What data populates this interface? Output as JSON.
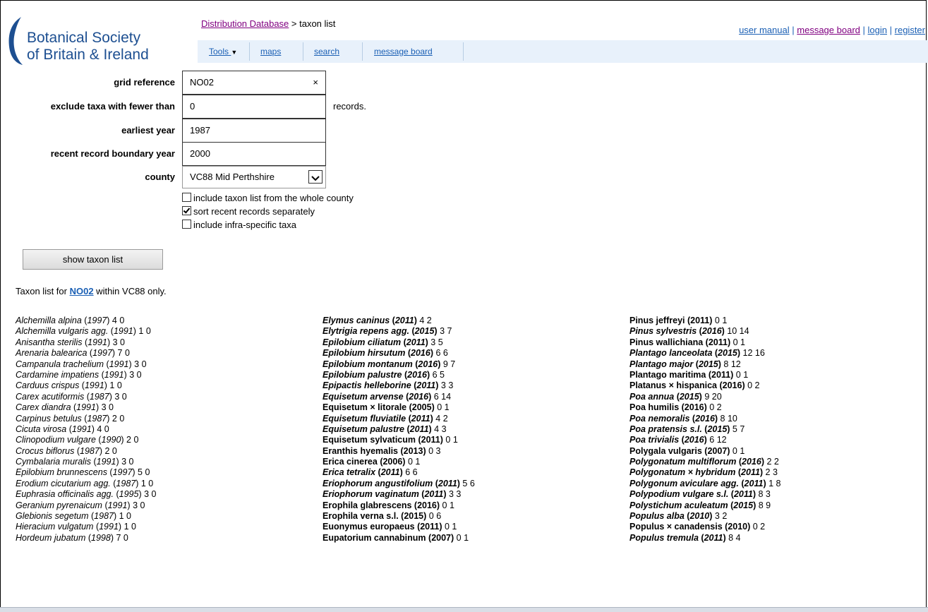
{
  "header": {
    "logo_line1": "Botanical Society",
    "logo_line2": "of Britain & Ireland",
    "breadcrumb_link": "Distribution Database",
    "breadcrumb_rest": " > taxon list",
    "toplinks": [
      "user manual",
      "message board",
      "login",
      "register"
    ]
  },
  "nav": {
    "tools": "Tools",
    "maps": "maps",
    "search": "search",
    "message_board": "message board"
  },
  "form": {
    "grid_reference_label": "grid reference",
    "grid_reference_value": "NO02",
    "clear_symbol": "×",
    "exclude_label": "exclude taxa with fewer than",
    "exclude_value": "0",
    "records_suffix": "records.",
    "earliest_year_label": "earliest year",
    "earliest_year_value": "1987",
    "boundary_label": "recent record boundary year",
    "boundary_value": "2000",
    "county_label": "county",
    "county_value": "VC88 Mid Perthshire",
    "cb_whole_county": "include taxon list from the whole county",
    "cb_sort_recent": "sort recent records separately",
    "cb_infra": "include infra-specific taxa",
    "show_button": "show taxon list"
  },
  "summary": {
    "prefix": "Taxon list for ",
    "grid": "NO02",
    "suffix": " within VC88 only."
  },
  "columns": [
    [
      {
        "name": "Alchemilla alpina",
        "year": "1997",
        "counts": "4 0",
        "style": "italic"
      },
      {
        "name": "Alchemilla vulgaris agg.",
        "year": "1991",
        "counts": "1 0",
        "style": "italic"
      },
      {
        "name": "Anisantha sterilis",
        "year": "1991",
        "counts": "3 0",
        "style": "italic"
      },
      {
        "name": "Arenaria balearica",
        "year": "1997",
        "counts": "7 0",
        "style": "italic"
      },
      {
        "name": "Campanula trachelium",
        "year": "1991",
        "counts": "3 0",
        "style": "italic"
      },
      {
        "name": "Cardamine impatiens",
        "year": "1991",
        "counts": "3 0",
        "style": "italic"
      },
      {
        "name": "Carduus crispus",
        "year": "1991",
        "counts": "1 0",
        "style": "italic"
      },
      {
        "name": "Carex acutiformis",
        "year": "1987",
        "counts": "3 0",
        "style": "italic"
      },
      {
        "name": "Carex diandra",
        "year": "1991",
        "counts": "3 0",
        "style": "italic"
      },
      {
        "name": "Carpinus betulus",
        "year": "1987",
        "counts": "2 0",
        "style": "italic"
      },
      {
        "name": "Cicuta virosa",
        "year": "1991",
        "counts": "4 0",
        "style": "italic"
      },
      {
        "name": "Clinopodium vulgare",
        "year": "1990",
        "counts": "2 0",
        "style": "italic"
      },
      {
        "name": "Crocus biflorus",
        "year": "1987",
        "counts": "2 0",
        "style": "italic"
      },
      {
        "name": "Cymbalaria muralis",
        "year": "1991",
        "counts": "3 0",
        "style": "italic"
      },
      {
        "name": "Epilobium brunnescens",
        "year": "1997",
        "counts": "5 0",
        "style": "italic"
      },
      {
        "name": "Erodium cicutarium agg.",
        "year": "1987",
        "counts": "1 0",
        "style": "italic"
      },
      {
        "name": "Euphrasia officinalis agg.",
        "year": "1995",
        "counts": "3 0",
        "style": "italic"
      },
      {
        "name": "Geranium pyrenaicum",
        "year": "1991",
        "counts": "3 0",
        "style": "italic"
      },
      {
        "name": "Glebionis segetum",
        "year": "1987",
        "counts": "1 0",
        "style": "italic"
      },
      {
        "name": "Hieracium vulgatum",
        "year": "1991",
        "counts": "1 0",
        "style": "italic"
      },
      {
        "name": "Hordeum jubatum",
        "year": "1998",
        "counts": "7 0",
        "style": "italic"
      }
    ],
    [
      {
        "name": "Elymus caninus",
        "year": "2011",
        "counts": "4 2",
        "style": "bold-italic"
      },
      {
        "name": "Elytrigia repens agg.",
        "year": "2015",
        "counts": "3 7",
        "style": "bold-italic"
      },
      {
        "name": "Epilobium ciliatum",
        "year": "2011",
        "counts": "3 5",
        "style": "bold-italic"
      },
      {
        "name": "Epilobium hirsutum",
        "year": "2016",
        "counts": "6 6",
        "style": "bold-italic"
      },
      {
        "name": "Epilobium montanum",
        "year": "2016",
        "counts": "9 7",
        "style": "bold-italic"
      },
      {
        "name": "Epilobium palustre",
        "year": "2016",
        "counts": "6 5",
        "style": "bold-italic"
      },
      {
        "name": "Epipactis helleborine",
        "year": "2011",
        "counts": "3 3",
        "style": "bold-italic"
      },
      {
        "name": "Equisetum arvense",
        "year": "2016",
        "counts": "6 14",
        "style": "bold-italic"
      },
      {
        "name": "Equisetum × litorale",
        "year": "2005",
        "counts": "0 1",
        "style": "bold"
      },
      {
        "name": "Equisetum fluviatile",
        "year": "2011",
        "counts": "4 2",
        "style": "bold-italic"
      },
      {
        "name": "Equisetum palustre",
        "year": "2011",
        "counts": "4 3",
        "style": "bold-italic"
      },
      {
        "name": "Equisetum sylvaticum",
        "year": "2011",
        "counts": "0 1",
        "style": "bold"
      },
      {
        "name": "Eranthis hyemalis",
        "year": "2013",
        "counts": "0 3",
        "style": "bold"
      },
      {
        "name": "Erica cinerea",
        "year": "2006",
        "counts": "0 1",
        "style": "bold"
      },
      {
        "name": "Erica tetralix",
        "year": "2011",
        "counts": "6 6",
        "style": "bold-italic"
      },
      {
        "name": "Eriophorum angustifolium",
        "year": "2011",
        "counts": "5 6",
        "style": "bold-italic"
      },
      {
        "name": "Eriophorum vaginatum",
        "year": "2011",
        "counts": "3 3",
        "style": "bold-italic"
      },
      {
        "name": "Erophila glabrescens",
        "year": "2016",
        "counts": "0 1",
        "style": "bold"
      },
      {
        "name": "Erophila verna s.l.",
        "year": "2015",
        "counts": "0 6",
        "style": "bold"
      },
      {
        "name": "Euonymus europaeus",
        "year": "2011",
        "counts": "0 1",
        "style": "bold"
      },
      {
        "name": "Eupatorium cannabinum",
        "year": "2007",
        "counts": "0 1",
        "style": "bold"
      }
    ],
    [
      {
        "name": "Pinus jeffreyi",
        "year": "2011",
        "counts": "0 1",
        "style": "bold"
      },
      {
        "name": "Pinus sylvestris",
        "year": "2016",
        "counts": "10 14",
        "style": "bold-italic"
      },
      {
        "name": "Pinus wallichiana",
        "year": "2011",
        "counts": "0 1",
        "style": "bold"
      },
      {
        "name": "Plantago lanceolata",
        "year": "2015",
        "counts": "12 16",
        "style": "bold-italic"
      },
      {
        "name": "Plantago major",
        "year": "2015",
        "counts": "8 12",
        "style": "bold-italic"
      },
      {
        "name": "Plantago maritima",
        "year": "2011",
        "counts": "0 1",
        "style": "bold"
      },
      {
        "name": "Platanus × hispanica",
        "year": "2016",
        "counts": "0 2",
        "style": "bold"
      },
      {
        "name": "Poa annua",
        "year": "2015",
        "counts": "9 20",
        "style": "bold-italic"
      },
      {
        "name": "Poa humilis",
        "year": "2016",
        "counts": "0 2",
        "style": "bold"
      },
      {
        "name": "Poa nemoralis",
        "year": "2016",
        "counts": "8 10",
        "style": "bold-italic"
      },
      {
        "name": "Poa pratensis s.l.",
        "year": "2015",
        "counts": "5 7",
        "style": "bold-italic"
      },
      {
        "name": "Poa trivialis",
        "year": "2016",
        "counts": "6 12",
        "style": "bold-italic"
      },
      {
        "name": "Polygala vulgaris",
        "year": "2007",
        "counts": "0 1",
        "style": "bold"
      },
      {
        "name": "Polygonatum multiflorum",
        "year": "2016",
        "counts": "2 2",
        "style": "bold-italic"
      },
      {
        "name": "Polygonatum × hybridum",
        "year": "2011",
        "counts": "2 3",
        "style": "bold-italic"
      },
      {
        "name": "Polygonum aviculare agg.",
        "year": "2011",
        "counts": "1 8",
        "style": "bold-italic"
      },
      {
        "name": "Polypodium vulgare s.l.",
        "year": "2011",
        "counts": "8 3",
        "style": "bold-italic"
      },
      {
        "name": "Polystichum aculeatum",
        "year": "2015",
        "counts": "8 9",
        "style": "bold-italic"
      },
      {
        "name": "Populus alba",
        "year": "2010",
        "counts": "3 2",
        "style": "bold-italic"
      },
      {
        "name": "Populus × canadensis",
        "year": "2010",
        "counts": "0 2",
        "style": "bold"
      },
      {
        "name": "Populus tremula",
        "year": "2011",
        "counts": "8 4",
        "style": "bold-italic"
      }
    ]
  ]
}
